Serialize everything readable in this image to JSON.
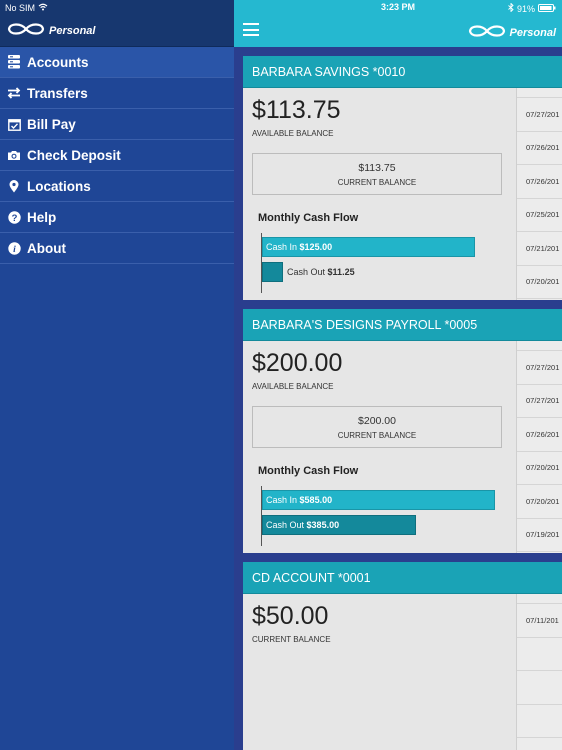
{
  "status": {
    "carrier": "No SIM",
    "time": "3:23 PM",
    "battery": "91%"
  },
  "brand": "Personal",
  "menu": [
    {
      "label": "Accounts",
      "icon": "accounts-icon"
    },
    {
      "label": "Transfers",
      "icon": "transfers-icon"
    },
    {
      "label": "Bill Pay",
      "icon": "calendar-check-icon"
    },
    {
      "label": "Check Deposit",
      "icon": "camera-icon"
    },
    {
      "label": "Locations",
      "icon": "location-pin-icon"
    },
    {
      "label": "Help",
      "icon": "help-icon"
    },
    {
      "label": "About",
      "icon": "info-icon"
    }
  ],
  "accounts": [
    {
      "name": "BARBARA SAVINGS *0010",
      "available": "$113.75",
      "available_label": "AVAILABLE BALANCE",
      "current": "$113.75",
      "current_label": "CURRENT BALANCE",
      "cashflow_title": "Monthly Cash Flow",
      "cash_in_label": "Cash In",
      "cash_in": "$125.00",
      "cash_out_label": "Cash Out",
      "cash_out": "$11.25",
      "cash_in_fraction": 1.0,
      "cash_out_fraction": 0.09,
      "dates": [
        "07/27/201",
        "07/26/201",
        "07/26/201",
        "07/25/201",
        "07/21/201",
        "07/20/201"
      ]
    },
    {
      "name": "BARBARA'S DESIGNS PAYROLL *0005",
      "available": "$200.00",
      "available_label": "AVAILABLE BALANCE",
      "current": "$200.00",
      "current_label": "CURRENT BALANCE",
      "cashflow_title": "Monthly Cash Flow",
      "cash_in_label": "Cash In",
      "cash_in": "$585.00",
      "cash_out_label": "Cash Out",
      "cash_out": "$385.00",
      "cash_in_fraction": 1.0,
      "cash_out_fraction": 0.66,
      "dates": [
        "07/27/201",
        "07/27/201",
        "07/26/201",
        "07/20/201",
        "07/20/201",
        "07/19/201"
      ]
    },
    {
      "name": "CD ACCOUNT *0001",
      "available": "$50.00",
      "available_label": "CURRENT BALANCE",
      "dates": [
        "07/11/201",
        "",
        "",
        ""
      ]
    }
  ]
}
